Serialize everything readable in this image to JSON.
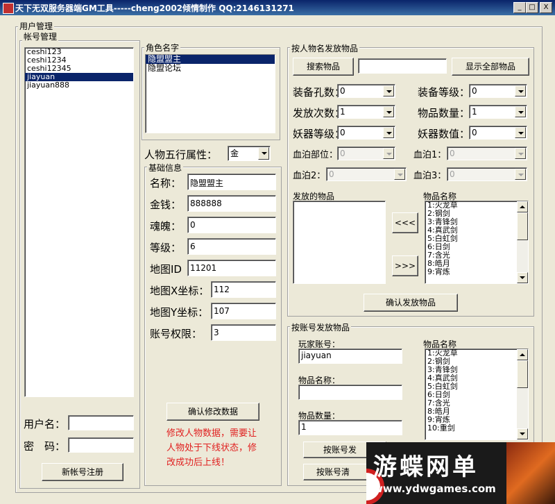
{
  "window": {
    "title": "天下无双服务器端GM工具-----cheng2002倾情制作    QQ:2146131271",
    "min": "_",
    "max": "□",
    "close": "X"
  },
  "user_mgmt": {
    "title": "用户管理"
  },
  "account": {
    "title": "帐号管理",
    "accounts": [
      "ceshi123",
      "ceshi1234",
      "ceshi12345",
      "jiayuan",
      "jiayuan888"
    ],
    "selected_index": 3,
    "username_label": "用户名：",
    "password_label": "密　码：",
    "username_value": "",
    "password_value": "",
    "register_button": "新帐号注册"
  },
  "roles": {
    "title": "角色名字",
    "items": [
      "隐盟盟主",
      "隐盟论坛"
    ],
    "selected_index": 0
  },
  "element_attr": {
    "label": "人物五行属性：",
    "value": "金"
  },
  "basic_info": {
    "title": "基础信息",
    "fields": [
      {
        "label": "名称：",
        "value": "隐盟盟主"
      },
      {
        "label": "金钱：",
        "value": "888888"
      },
      {
        "label": "魂魄：",
        "value": "0"
      },
      {
        "label": "等级：",
        "value": "6"
      },
      {
        "label": "地图ID",
        "value": "11201"
      },
      {
        "label": "地图X坐标：",
        "value": "112"
      },
      {
        "label": "地图Y坐标：",
        "value": "107"
      },
      {
        "label": "账号权限：",
        "value": "3"
      }
    ],
    "confirm_button": "确认修改数据",
    "notice": [
      "修改人物数据，需要让",
      "人物处于下线状态，修",
      "改成功后上线！"
    ]
  },
  "by_char": {
    "title": "按人物名发放物品",
    "search_button": "搜索物品",
    "search_value": "",
    "show_all_button": "显示全部物品",
    "rows": [
      [
        {
          "label": "装备孔数：",
          "value": "0",
          "enabled": true
        },
        {
          "label": "装备等级：",
          "value": "0",
          "enabled": true
        }
      ],
      [
        {
          "label": "发放次数：",
          "value": "1",
          "enabled": true
        },
        {
          "label": "物品数量：",
          "value": "1",
          "enabled": true
        }
      ],
      [
        {
          "label": "妖器等级：",
          "value": "0",
          "enabled": true
        },
        {
          "label": "妖器数值：",
          "value": "0",
          "enabled": true
        }
      ],
      [
        {
          "label": "血泊部位：",
          "value": "0",
          "enabled": false
        },
        {
          "label": "血泊1：",
          "value": "0",
          "enabled": false
        }
      ],
      [
        {
          "label": "血泊2：",
          "value": "0",
          "enabled": false
        },
        {
          "label": "血泊3：",
          "value": "0",
          "enabled": false
        }
      ]
    ],
    "sent_items_label": "发放的物品",
    "item_names_label": "物品名称",
    "item_names": [
      "1:火龙草",
      "2:钢剑",
      "3:青锋剑",
      "4:真武剑",
      "5:白虹剑",
      "6:日剑",
      "7:含光",
      "8:皓月",
      "9:宵炼"
    ],
    "move_left": "<<<",
    "move_right": ">>>",
    "confirm_button": "确认发放物品"
  },
  "by_account": {
    "title": "按账号发放物品",
    "player_account_label": "玩家账号：",
    "player_account_value": "jiayuan",
    "item_name_label": "物品名称：",
    "item_name_value": "",
    "item_count_label": "物品数量：",
    "item_count_value": "1",
    "item_names_label": "物品名称",
    "item_names": [
      "1:火龙草",
      "2:钢剑",
      "3:青锋剑",
      "4:真武剑",
      "5:白虹剑",
      "6:日剑",
      "7:含光",
      "8:皓月",
      "9:宵炼",
      "10:重剑"
    ],
    "send_button": "按账号发",
    "clear_button": "按账号清"
  },
  "watermark": {
    "text": "游蝶网单",
    "url": "www.ydwgames.com"
  }
}
